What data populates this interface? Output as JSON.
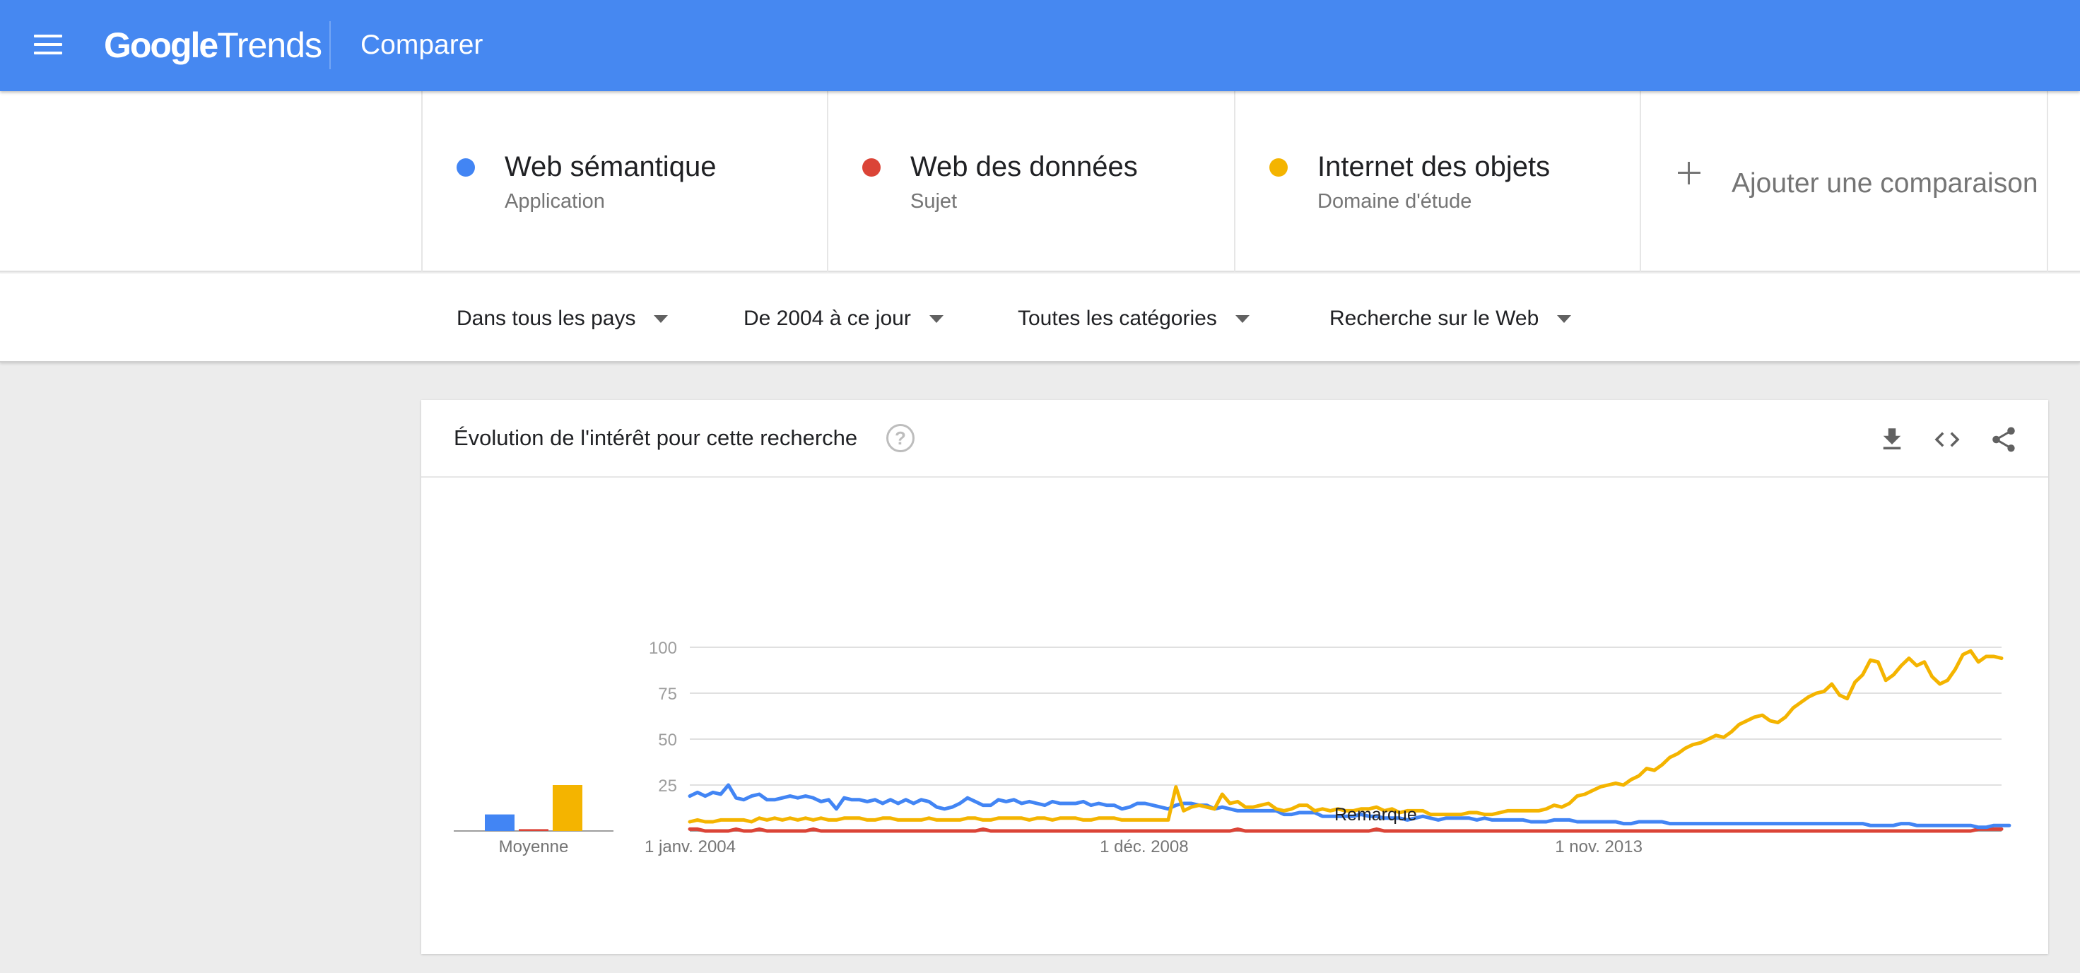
{
  "header": {
    "logo_google": "Google",
    "logo_trends": "Trends",
    "title": "Comparer",
    "menu_icon": "menu-icon"
  },
  "terms": [
    {
      "name": "Web sémantique",
      "type": "Application",
      "color": "#4285f4"
    },
    {
      "name": "Web des données",
      "type": "Sujet",
      "color": "#db4437"
    },
    {
      "name": "Internet des objets",
      "type": "Domaine d'étude",
      "color": "#f4b400"
    }
  ],
  "add_comparison": {
    "label": "Ajouter une comparaison",
    "icon": "plus-icon"
  },
  "filters": [
    {
      "label": "Dans tous les pays"
    },
    {
      "label": "De 2004 à ce jour"
    },
    {
      "label": "Toutes les catégories"
    },
    {
      "label": "Recherche sur le Web"
    }
  ],
  "card": {
    "title": "Évolution de l'intérêt pour cette recherche",
    "help_icon": "?",
    "tools": [
      "download-icon",
      "embed-code-icon",
      "share-icon"
    ],
    "remark": "Remarque"
  },
  "chart_data": {
    "type": "line",
    "y_ticks": [
      "100",
      "75",
      "50",
      "25"
    ],
    "ylim": [
      0,
      100
    ],
    "x_tick_labels": [
      "1 janv. 2004",
      "1 déc. 2008",
      "1 nov. 2013"
    ],
    "x_tick_positions": [
      0,
      59,
      118
    ],
    "x_range": [
      0,
      170
    ],
    "grid": true,
    "average_label": "Moyenne",
    "averages": [
      9,
      1,
      25
    ],
    "series": [
      {
        "name": "Web sémantique",
        "color": "#4285f4",
        "values": [
          19,
          21,
          19,
          21,
          20,
          25,
          18,
          17,
          19,
          20,
          17,
          17,
          18,
          19,
          18,
          19,
          18,
          16,
          17,
          12,
          18,
          17,
          17,
          16,
          17,
          15,
          17,
          15,
          17,
          15,
          17,
          16,
          13,
          12,
          13,
          15,
          18,
          16,
          14,
          14,
          17,
          16,
          17,
          15,
          16,
          15,
          14,
          16,
          15,
          15,
          15,
          16,
          14,
          15,
          14,
          14,
          12,
          13,
          15,
          15,
          14,
          13,
          12,
          14,
          15,
          15,
          14,
          14,
          12,
          13,
          12,
          11,
          11,
          11,
          11,
          11,
          11,
          9,
          9,
          10,
          10,
          10,
          8,
          8,
          8,
          8,
          8,
          9,
          8,
          8,
          7,
          7,
          7,
          6,
          7,
          8,
          7,
          6,
          7,
          7,
          7,
          7,
          6,
          7,
          6,
          6,
          6,
          6,
          6,
          5,
          5,
          5,
          6,
          6,
          6,
          5,
          5,
          5,
          5,
          5,
          5,
          4,
          4,
          5,
          5,
          5,
          5,
          4,
          4,
          4,
          4,
          4,
          4,
          4,
          4,
          4,
          4,
          4,
          4,
          4,
          4,
          4,
          4,
          4,
          4,
          4,
          4,
          4,
          4,
          4,
          4,
          4,
          4,
          3,
          3,
          3,
          3,
          4,
          4,
          3,
          3,
          3,
          3,
          3,
          3,
          3,
          3,
          2,
          2,
          3,
          3,
          3
        ]
      },
      {
        "name": "Web des données",
        "color": "#db4437",
        "values": [
          1,
          1,
          0,
          0,
          0,
          0,
          1,
          0,
          0,
          1,
          0,
          0,
          0,
          0,
          0,
          0,
          1,
          0,
          0,
          0,
          0,
          0,
          0,
          0,
          0,
          0,
          0,
          0,
          0,
          0,
          0,
          0,
          0,
          0,
          0,
          0,
          0,
          0,
          1,
          0,
          0,
          0,
          0,
          0,
          0,
          0,
          0,
          0,
          0,
          0,
          0,
          0,
          0,
          0,
          0,
          0,
          0,
          0,
          0,
          0,
          0,
          0,
          0,
          0,
          0,
          0,
          0,
          0,
          0,
          0,
          0,
          1,
          0,
          0,
          0,
          0,
          0,
          0,
          0,
          0,
          0,
          0,
          0,
          0,
          0,
          0,
          0,
          0,
          0,
          1,
          0,
          0,
          0,
          0,
          0,
          0,
          0,
          0,
          0,
          0,
          0,
          0,
          0,
          0,
          0,
          0,
          0,
          0,
          0,
          0,
          0,
          0,
          0,
          0,
          0,
          0,
          0,
          0,
          0,
          0,
          0,
          0,
          0,
          0,
          0,
          0,
          0,
          0,
          0,
          0,
          0,
          0,
          0,
          0,
          0,
          0,
          0,
          0,
          0,
          0,
          0,
          0,
          0,
          0,
          0,
          0,
          0,
          0,
          0,
          0,
          0,
          0,
          0,
          0,
          0,
          0,
          0,
          0,
          0,
          0,
          0,
          0,
          0,
          0,
          0,
          0,
          0,
          1,
          1,
          1,
          1
        ]
      },
      {
        "name": "Internet des objets",
        "color": "#f4b400",
        "values": [
          5,
          6,
          5,
          5,
          6,
          6,
          6,
          6,
          5,
          7,
          6,
          7,
          6,
          7,
          6,
          7,
          6,
          7,
          6,
          6,
          7,
          7,
          7,
          6,
          6,
          7,
          7,
          6,
          6,
          6,
          6,
          7,
          6,
          6,
          6,
          6,
          7,
          7,
          6,
          6,
          7,
          7,
          7,
          7,
          6,
          7,
          7,
          6,
          7,
          7,
          7,
          6,
          6,
          7,
          7,
          7,
          6,
          6,
          6,
          6,
          6,
          6,
          6,
          24,
          11,
          13,
          14,
          13,
          12,
          20,
          15,
          16,
          13,
          13,
          14,
          15,
          12,
          11,
          12,
          14,
          14,
          11,
          12,
          11,
          12,
          11,
          11,
          12,
          12,
          13,
          11,
          12,
          10,
          11,
          11,
          11,
          9,
          9,
          9,
          9,
          9,
          10,
          10,
          9,
          9,
          10,
          11,
          11,
          11,
          11,
          11,
          12,
          14,
          13,
          15,
          19,
          20,
          22,
          24,
          25,
          26,
          25,
          28,
          30,
          34,
          33,
          36,
          40,
          42,
          45,
          47,
          48,
          50,
          52,
          51,
          54,
          58,
          60,
          62,
          63,
          60,
          59,
          62,
          67,
          70,
          73,
          75,
          76,
          80,
          74,
          72,
          81,
          85,
          93,
          92,
          82,
          85,
          90,
          94,
          90,
          92,
          84,
          80,
          82,
          88,
          96,
          98,
          92,
          95,
          95,
          94
        ]
      }
    ]
  }
}
